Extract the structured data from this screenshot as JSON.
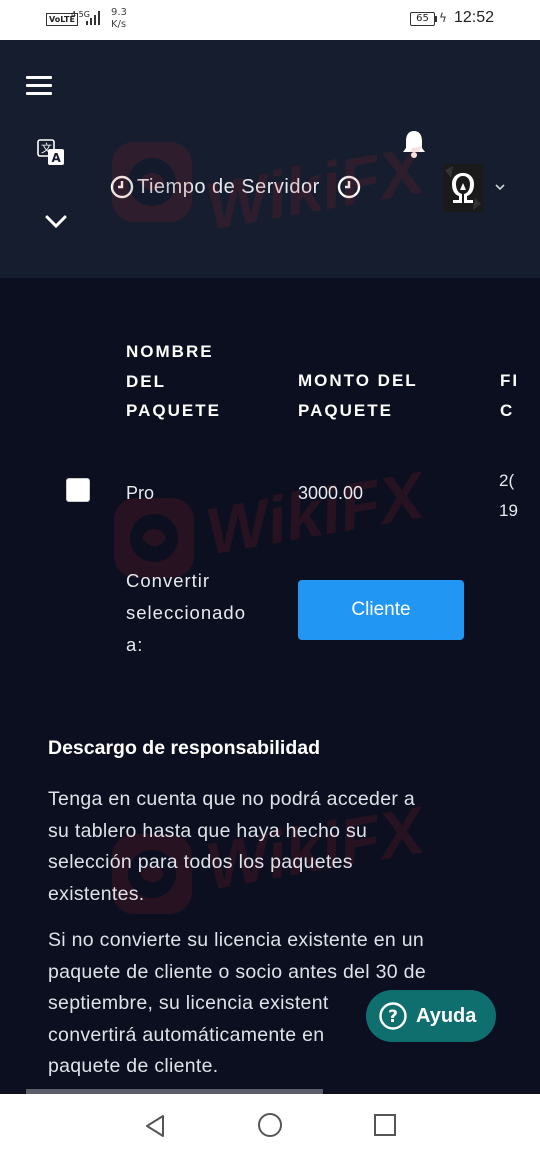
{
  "status_bar": {
    "volte": "VoLTE",
    "network": "4.5G",
    "speed_value": "9.3",
    "speed_unit": "K/s",
    "battery": "65",
    "time": "12:52"
  },
  "header": {
    "server_time_label": "Tiempo de Servidor",
    "icons": [
      "menu-icon",
      "translate-icon",
      "bell-icon",
      "clock-icon",
      "chevron-down-icon"
    ]
  },
  "table": {
    "columns": [
      {
        "lines": [
          "NOMBRE",
          "DEL",
          "PAQUETE"
        ]
      },
      {
        "lines": [
          "MONTO DEL",
          "PAQUETE"
        ]
      },
      {
        "lines": [
          "FI",
          "C"
        ]
      }
    ],
    "row": {
      "package_name": "Pro",
      "amount": "3000.00",
      "date_partial_1": "2(",
      "date_partial_2": "19"
    }
  },
  "convert": {
    "label_lines": [
      "Convertir",
      "seleccionado",
      "a:"
    ],
    "button_label": "Cliente"
  },
  "disclaimer": {
    "title": "Descargo de responsabilidad",
    "paragraph1_lines": [
      "Tenga en cuenta que no podrá acceder a",
      "su tablero hasta que haya hecho su",
      "selección para todos los paquetes",
      "existentes."
    ],
    "paragraph2_lines": [
      "Si no convierte su licencia existente en un",
      "paquete de cliente o socio antes del 30 de",
      "septiembre, su licencia existent",
      "convertirá automáticamente en",
      "paquete de cliente."
    ]
  },
  "help": {
    "label": "Ayuda"
  },
  "watermark": "WikiFX",
  "colors": {
    "header_bg": "#151d2e",
    "page_bg": "#0b0f1f",
    "accent": "#2196f3",
    "help_bg": "#0f6e6e"
  }
}
